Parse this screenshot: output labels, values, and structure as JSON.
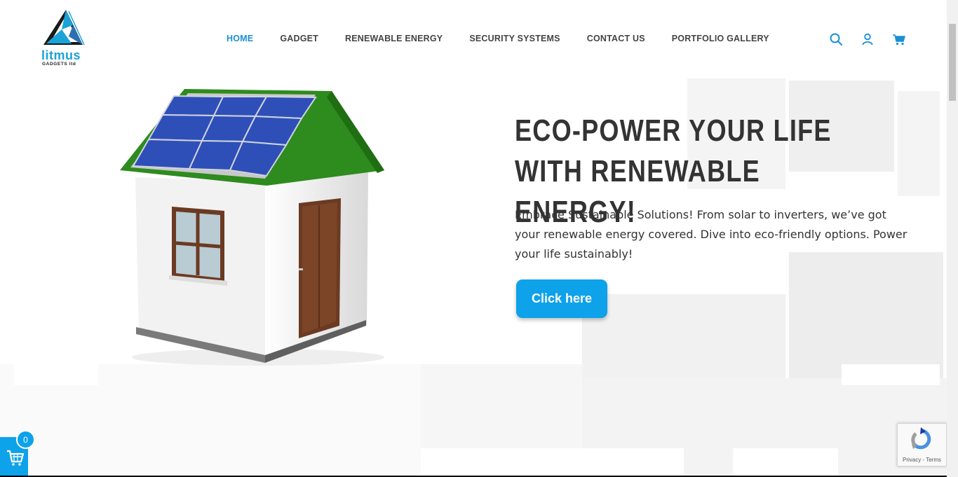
{
  "logo": {
    "name": "litmus",
    "subtitle": "GADGETS ltd"
  },
  "nav": {
    "items": [
      {
        "label": "HOME",
        "active": true
      },
      {
        "label": "GADGET",
        "active": false
      },
      {
        "label": "RENEWABLE ENERGY",
        "active": false
      },
      {
        "label": "SECURITY SYSTEMS",
        "active": false
      },
      {
        "label": "CONTACT US",
        "active": false
      },
      {
        "label": "PORTFOLIO GALLERY",
        "active": false
      }
    ]
  },
  "header_icons": [
    "search-icon",
    "user-icon",
    "cart-icon"
  ],
  "hero": {
    "title": "ECO-POWER YOUR LIFE WITH RENEWABLE ENERGY!",
    "description": "Embrace Sustainable Solutions! From solar to inverters, we’ve got your renewable energy covered. Dive into eco-friendly options. Power your life sustainably!",
    "cta_label": "Click here"
  },
  "floating_cart": {
    "count": "0"
  },
  "recaptcha": {
    "links": "Privacy - Terms"
  },
  "colors": {
    "accent": "#0da2ea",
    "nav_active": "#1a8fd4",
    "roof": "#2e8b1e",
    "panel": "#2f4fb8"
  }
}
